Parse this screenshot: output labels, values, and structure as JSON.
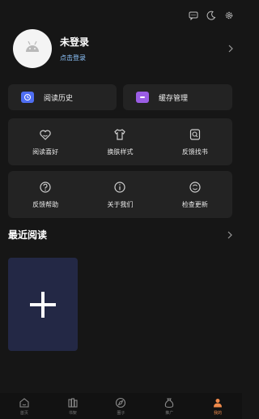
{
  "profile": {
    "username": "未登录",
    "login_hint": "点击登录"
  },
  "top_icons": [
    "message-icon",
    "moon-icon",
    "settings-icon"
  ],
  "quick_actions": [
    {
      "label": "阅读历史",
      "icon": "history-icon",
      "color": "#4f6ef2"
    },
    {
      "label": "缓存管理",
      "icon": "cache-icon",
      "color": "#9b5de5"
    }
  ],
  "grid_row_1": [
    {
      "label": "阅读喜好",
      "icon": "heart-icon"
    },
    {
      "label": "换肤样式",
      "icon": "shirt-icon"
    },
    {
      "label": "反馈找书",
      "icon": "search-book-icon"
    }
  ],
  "grid_row_2": [
    {
      "label": "反馈帮助",
      "icon": "help-icon"
    },
    {
      "label": "关于我们",
      "icon": "info-icon"
    },
    {
      "label": "检查更新",
      "icon": "update-icon"
    }
  ],
  "recent": {
    "title": "最近阅读"
  },
  "tabs": [
    {
      "label": "首页",
      "icon": "home-icon",
      "active": false
    },
    {
      "label": "书架",
      "icon": "bookshelf-icon",
      "active": false
    },
    {
      "label": "圈子",
      "icon": "compass-icon",
      "active": false
    },
    {
      "label": "推广",
      "icon": "money-bag-icon",
      "active": false
    },
    {
      "label": "我的",
      "icon": "profile-icon",
      "active": true
    }
  ],
  "colors": {
    "background": "#161616",
    "card": "#232323",
    "accent": "#f08a4b",
    "login_hint": "#8fc6ff",
    "add_tile": "#232845"
  }
}
